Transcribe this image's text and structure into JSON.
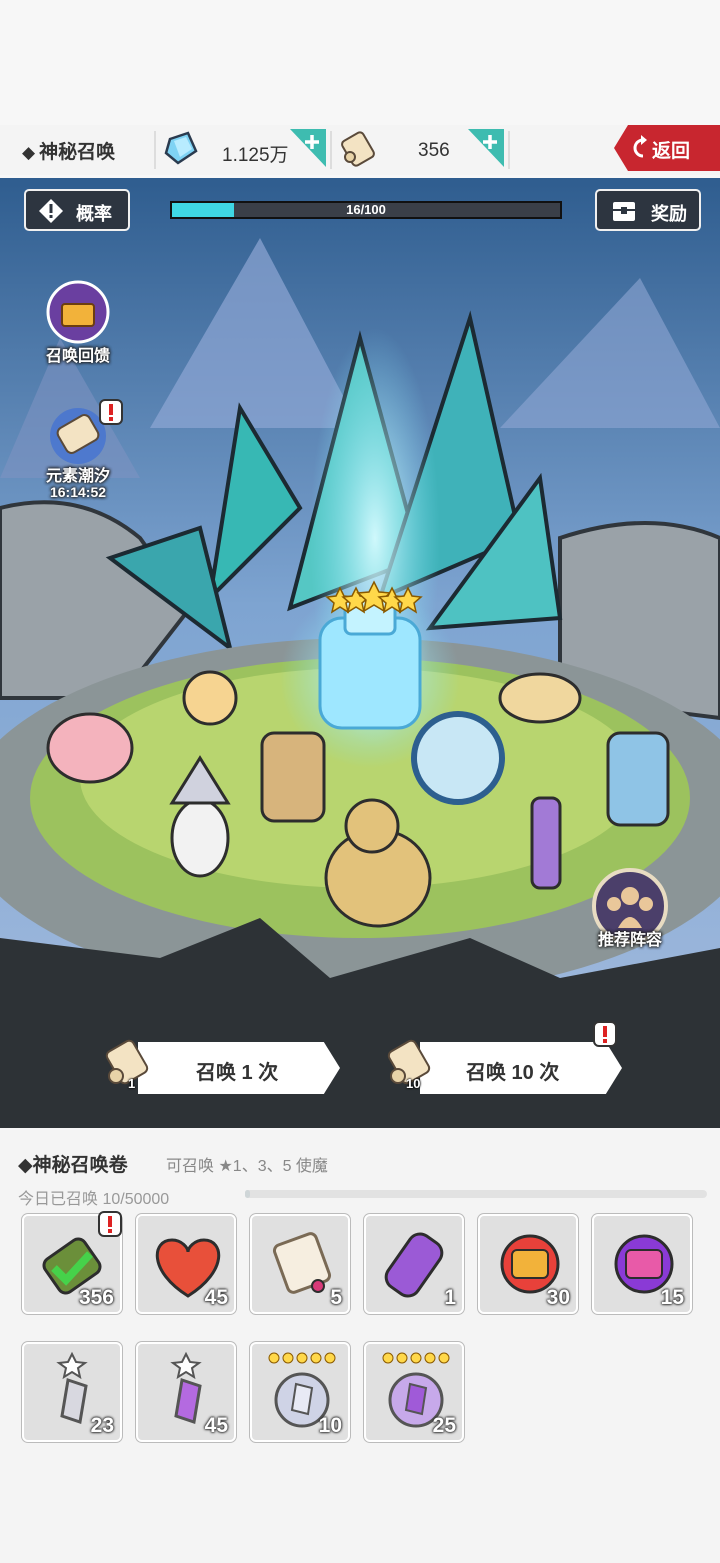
{
  "header": {
    "title": "神秘召唤",
    "gems": "1.125万",
    "scrolls": "356",
    "back_label": "返回"
  },
  "scene": {
    "prob_label": "概率",
    "rewards_label": "奖励",
    "progress": {
      "text": "16/100",
      "current": 16,
      "max": 100
    },
    "feedback_label": "召唤回馈",
    "event_label": "元素潮汐",
    "event_timer": "16:14:52",
    "recommend_label": "推荐阵容",
    "summon_one": {
      "label": "召唤 1 次",
      "cost": "1"
    },
    "summon_ten": {
      "label": "召唤 10 次",
      "cost": "10"
    }
  },
  "panel": {
    "title": "◆神秘召唤卷",
    "subtitle": "可召唤 ★1、3、5 使魔",
    "daily": "今日已召唤 10/50000",
    "daily_progress": 0.0002,
    "items": [
      {
        "name": "mystic-scroll",
        "qty": "356"
      },
      {
        "name": "heart",
        "qty": "45"
      },
      {
        "name": "paper-scroll",
        "qty": "5"
      },
      {
        "name": "purple-scroll",
        "qty": "1"
      },
      {
        "name": "fire-scroll",
        "qty": "30"
      },
      {
        "name": "arcane-scroll",
        "qty": "15"
      },
      {
        "name": "grey-shard-1star",
        "qty": "23"
      },
      {
        "name": "purple-shard-1star",
        "qty": "45"
      },
      {
        "name": "grey-crystal-5star",
        "qty": "10"
      },
      {
        "name": "purple-crystal-5star",
        "qty": "25"
      }
    ]
  },
  "colors": {
    "accent_teal": "#3ebcb0",
    "back_red": "#c8262f",
    "progress_fill": "#3fd7e4"
  }
}
